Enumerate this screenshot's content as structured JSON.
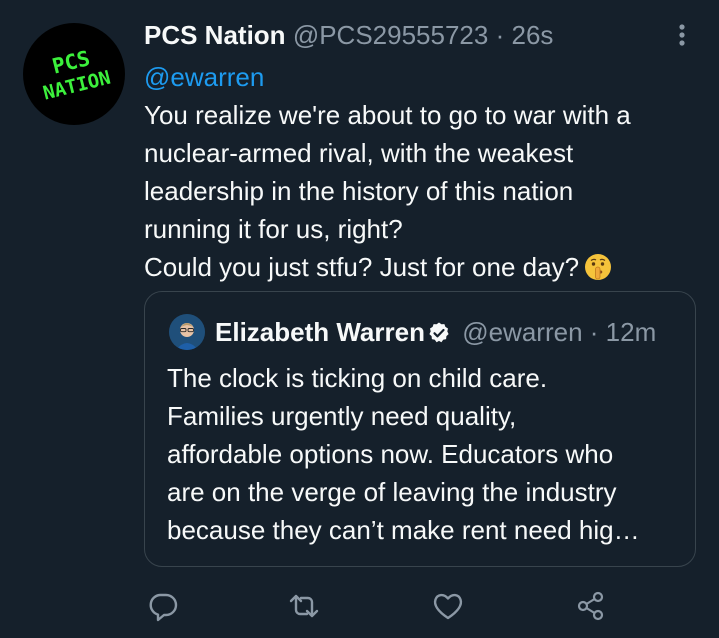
{
  "tweet": {
    "avatar_text_top": "PCS",
    "avatar_text_bottom": "NATION",
    "display_name": "PCS Nation",
    "handle": "@PCS29555723",
    "separator": "·",
    "time": "26s",
    "mention": "@ewarren",
    "lines": [
      "You realize we're about to go to war with a",
      "nuclear-armed rival, with the weakest",
      "leadership in the history of this nation",
      "running it for us, right?",
      "Could you just stfu? Just for one day?"
    ],
    "emoji_icon": "shushing-face-emoji"
  },
  "quoted_tweet": {
    "display_name": "Elizabeth Warren",
    "verified_icon": "verified-badge-icon",
    "handle": "@ewarren",
    "separator": "·",
    "time": "12m",
    "lines": [
      "The clock is ticking on child care.",
      "Families urgently need quality,",
      "affordable options now. Educators who",
      "are on the verge of leaving the industry",
      "because they can’t make rent need hig…"
    ]
  },
  "actions": [
    "reply-icon",
    "retweet-icon",
    "like-icon",
    "share-icon"
  ],
  "colors": {
    "background": "#15202b",
    "text": "#f7f9f9",
    "secondary": "#8b98a5",
    "link": "#1d9bf0",
    "border": "#38444d",
    "avatar_accent": "#3cf03c"
  }
}
